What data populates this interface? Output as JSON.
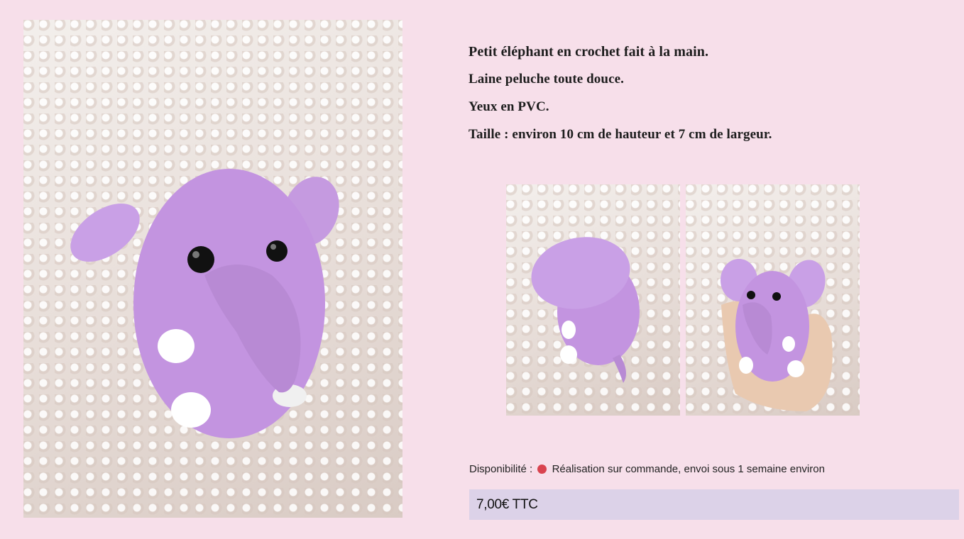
{
  "product": {
    "title": "Petit éléphant en crochet fait à la main.",
    "details": [
      "Laine peluche toute douce.",
      "Yeux en PVC.",
      "Taille : environ 10 cm de hauteur et 7 cm de largeur."
    ]
  },
  "availability": {
    "label": "Disponibilité :",
    "status_color": "#d9434f",
    "status_text": "Réalisation sur commande, envoi sous 1 semaine environ"
  },
  "price": {
    "text": "7,00€ TTC"
  },
  "images": {
    "main": "elephant-front-photo",
    "thumbnails": [
      "elephant-side-photo",
      "elephant-in-hand-photo"
    ]
  },
  "colors": {
    "background": "#f7dfea",
    "price_box": "#dcd2e8",
    "plush": "#c59ae0"
  }
}
